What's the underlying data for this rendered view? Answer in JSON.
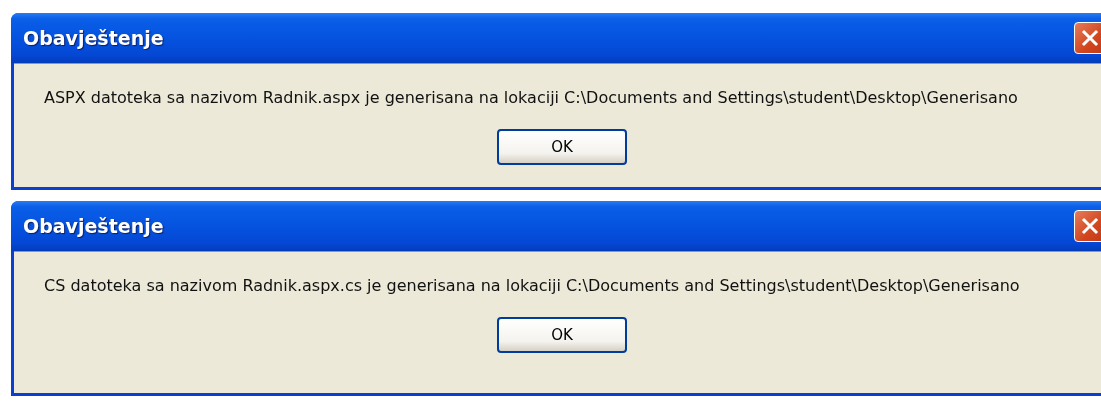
{
  "dialogs": [
    {
      "title": "Obavještenje",
      "message": "ASPX datoteka sa nazivom Radnik.aspx je generisana na lokaciji C:\\Documents and Settings\\student\\Desktop\\Generisano",
      "button": "OK"
    },
    {
      "title": "Obavještenje",
      "message": "CS datoteka sa nazivom Radnik.aspx.cs je generisana na lokaciji C:\\Documents and Settings\\student\\Desktop\\Generisano",
      "button": "OK"
    }
  ]
}
